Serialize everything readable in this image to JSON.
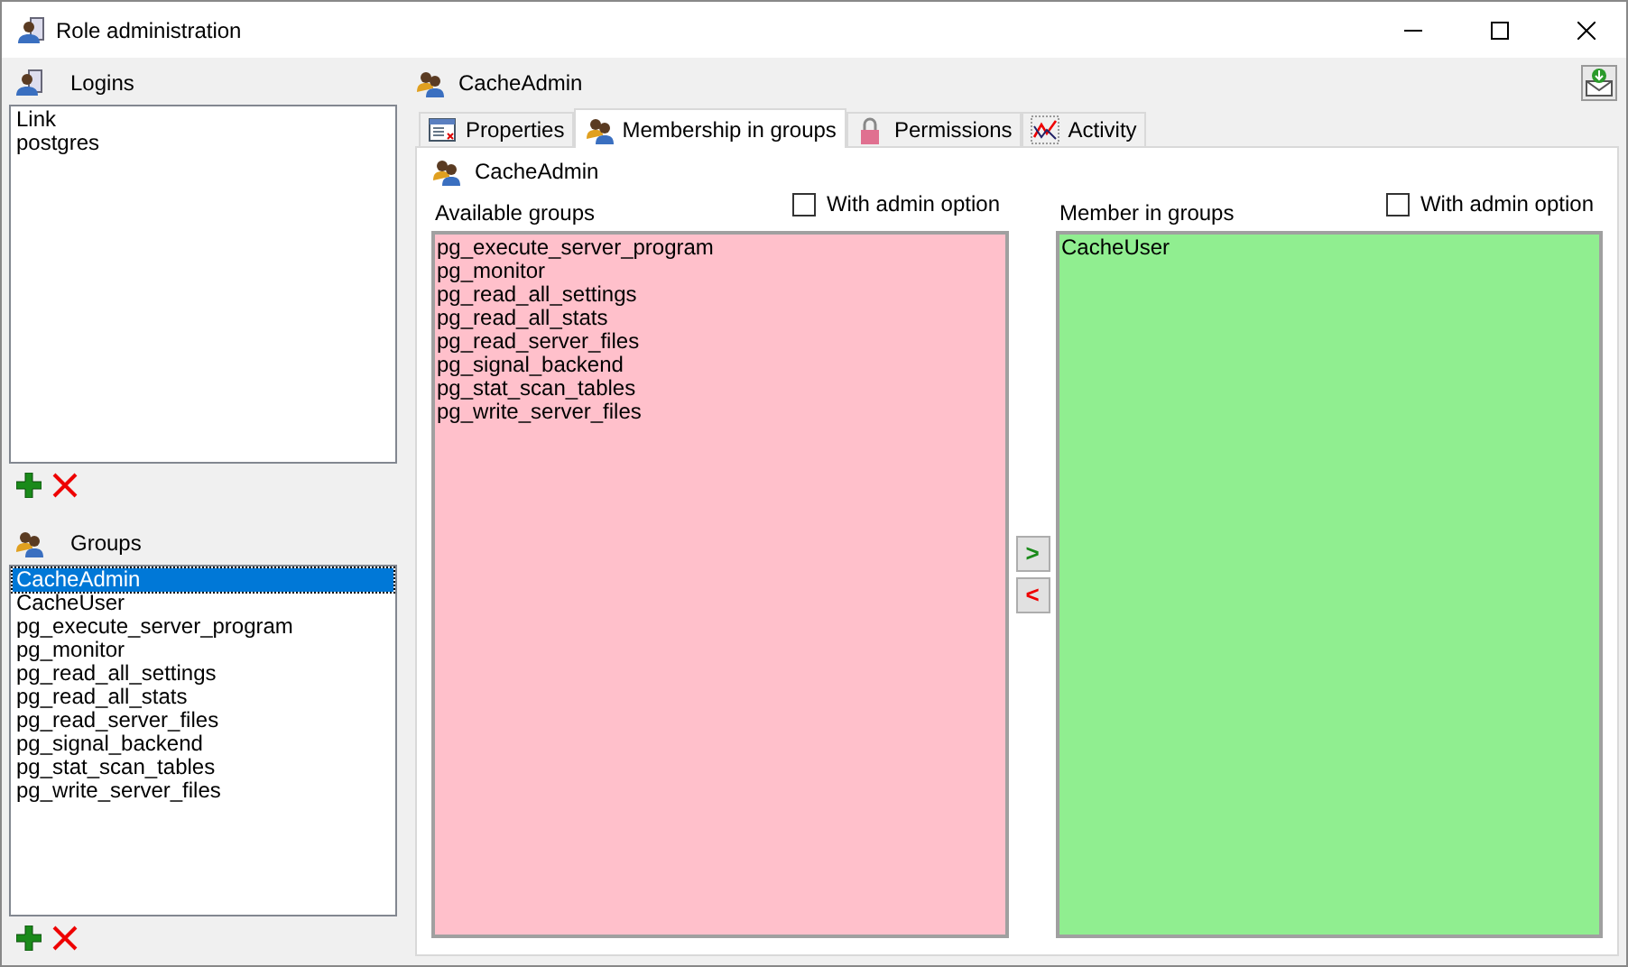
{
  "window": {
    "title": "Role administration"
  },
  "logins": {
    "title": "Logins",
    "items": [
      {
        "label": "Link",
        "selected": false
      },
      {
        "label": "postgres",
        "selected": false
      }
    ]
  },
  "groups": {
    "title": "Groups",
    "items": [
      {
        "label": "CacheAdmin",
        "selected": true
      },
      {
        "label": "CacheUser",
        "selected": false
      },
      {
        "label": "pg_execute_server_program",
        "selected": false
      },
      {
        "label": "pg_monitor",
        "selected": false
      },
      {
        "label": "pg_read_all_settings",
        "selected": false
      },
      {
        "label": "pg_read_all_stats",
        "selected": false
      },
      {
        "label": "pg_read_server_files",
        "selected": false
      },
      {
        "label": "pg_signal_backend",
        "selected": false
      },
      {
        "label": "pg_stat_scan_tables",
        "selected": false
      },
      {
        "label": "pg_write_server_files",
        "selected": false
      }
    ]
  },
  "role": {
    "name": "CacheAdmin"
  },
  "tabs": [
    {
      "label": "Properties",
      "kind": "properties",
      "selected": false
    },
    {
      "label": "Membership in groups",
      "kind": "users",
      "selected": true
    },
    {
      "label": "Permissions",
      "kind": "lock",
      "selected": false
    },
    {
      "label": "Activity",
      "kind": "chart",
      "selected": false
    }
  ],
  "membership": {
    "role": "CacheAdmin",
    "available": {
      "title": "Available groups",
      "admin_option": {
        "label": "With admin option",
        "checked": false
      },
      "items": [
        {
          "label": "pg_execute_server_program"
        },
        {
          "label": "pg_monitor"
        },
        {
          "label": "pg_read_all_settings"
        },
        {
          "label": "pg_read_all_stats"
        },
        {
          "label": "pg_read_server_files"
        },
        {
          "label": "pg_signal_backend"
        },
        {
          "label": "pg_stat_scan_tables"
        },
        {
          "label": "pg_write_server_files"
        }
      ]
    },
    "member": {
      "title": "Member in groups",
      "admin_option": {
        "label": "With admin option",
        "checked": false
      },
      "items": [
        {
          "label": "CacheUser"
        }
      ]
    },
    "add_label": ">",
    "remove_label": "<"
  }
}
